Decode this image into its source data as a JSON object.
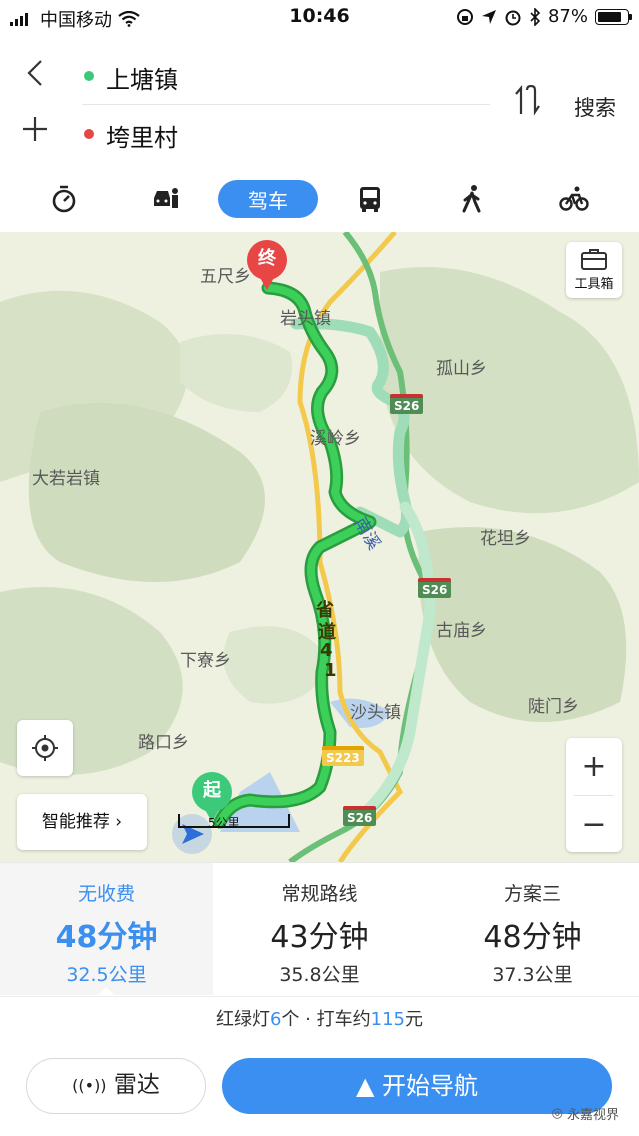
{
  "status_bar": {
    "carrier": "中国移动",
    "time": "10:46",
    "battery": "87%",
    "battery_level": 0.87
  },
  "header": {
    "origin": "上塘镇",
    "destination": "垮里村",
    "search_label": "搜索",
    "colors": {
      "origin_dot": "#3cc97a",
      "destination_dot": "#e84545"
    }
  },
  "modes": [
    {
      "name": "timer-icon"
    },
    {
      "name": "taxi-icon"
    },
    {
      "label": "驾车"
    },
    {
      "name": "bus-icon"
    },
    {
      "name": "walk-icon"
    },
    {
      "name": "bike-icon"
    }
  ],
  "map": {
    "labels": {
      "wuchi": "五尺乡",
      "yantou": "岩头镇",
      "gushan": "孤山乡",
      "xiyan": "溪岭乡",
      "daruoyan": "大若岩镇",
      "huatan": "花坦乡",
      "gumiao": "古庙乡",
      "xialiao": "下寮乡",
      "shatou": "沙头镇",
      "lukou": "路口乡",
      "dianmen": "陡门乡",
      "nan": "南溪"
    },
    "shields": {
      "s26a": "S26",
      "s26b": "S26",
      "s26c": "S26",
      "s223": "S223"
    },
    "road_text": [
      "省",
      "道",
      "4",
      "1"
    ],
    "tool_box": "工具箱",
    "smart_recommend": "智能推荐",
    "end_pin": "终",
    "start_pin": "起",
    "scale": "5公里",
    "zoom_in": "+",
    "zoom_out": "−"
  },
  "routes": [
    {
      "label": "无收费",
      "time": "48分钟",
      "dist": "32.5公里"
    },
    {
      "label": "常规路线",
      "time": "43分钟",
      "dist": "35.8公里"
    },
    {
      "label": "方案三",
      "time": "48分钟",
      "dist": "37.3公里"
    }
  ],
  "info": {
    "lights_prefix": "红绿灯",
    "lights_count": "6",
    "lights_suffix": "个 · 打车约",
    "fare": "115",
    "fare_suffix": "元"
  },
  "bottom": {
    "radar": "雷达",
    "start_nav": "开始导航",
    "watermark": "永嘉视界"
  }
}
